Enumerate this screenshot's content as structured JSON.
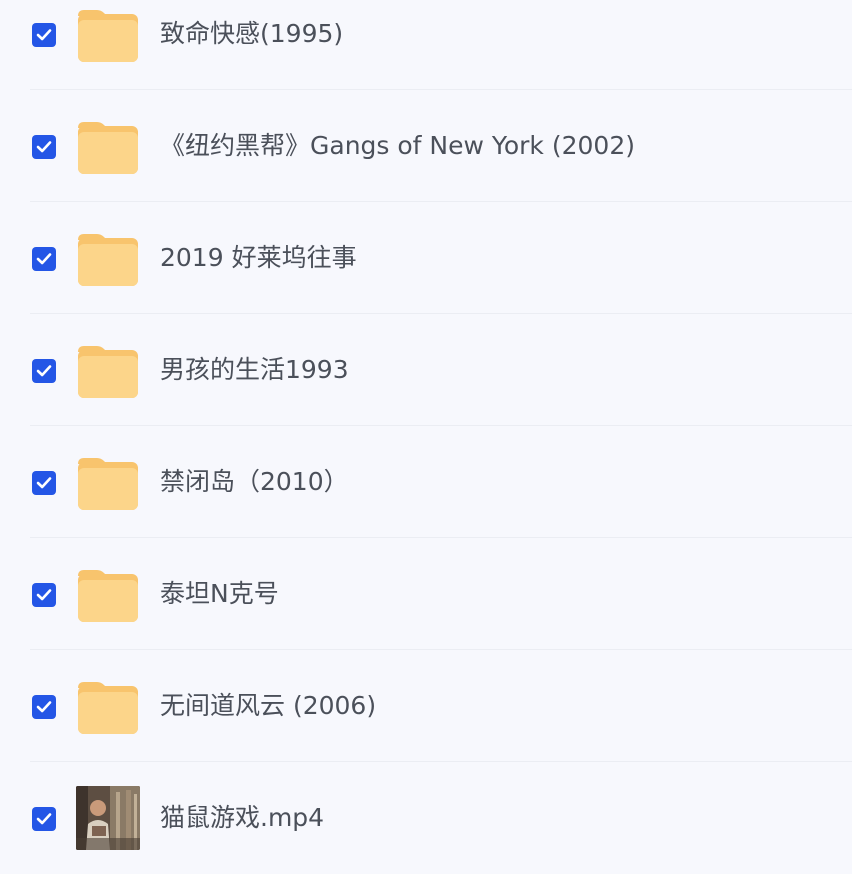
{
  "files": [
    {
      "name": "致命快感(1995)",
      "type": "folder",
      "checked": true,
      "thumb_icon": "folder-icon"
    },
    {
      "name": "《纽约黑帮》Gangs of New York (2002)",
      "type": "folder",
      "checked": true,
      "thumb_icon": "folder-icon"
    },
    {
      "name": "2019 好莱坞往事",
      "type": "folder",
      "checked": true,
      "thumb_icon": "folder-icon"
    },
    {
      "name": "男孩的生活1993",
      "type": "folder",
      "checked": true,
      "thumb_icon": "folder-icon"
    },
    {
      "name": "禁闭岛（2010）",
      "type": "folder",
      "checked": true,
      "thumb_icon": "folder-icon"
    },
    {
      "name": "泰坦N克号",
      "type": "folder",
      "checked": true,
      "thumb_icon": "folder-icon"
    },
    {
      "name": "无间道风云 (2006)",
      "type": "folder",
      "checked": true,
      "thumb_icon": "folder-icon"
    },
    {
      "name": "猫鼠游戏.mp4",
      "type": "video",
      "checked": true,
      "thumb_icon": "video-thumbnail"
    }
  ],
  "colors": {
    "background": "#f7f8fd",
    "checkbox": "#2456e6",
    "folder_light": "#fcd58a",
    "folder_dark": "#f8c46d",
    "text": "#4b505a",
    "divider": "#ebedf3"
  }
}
